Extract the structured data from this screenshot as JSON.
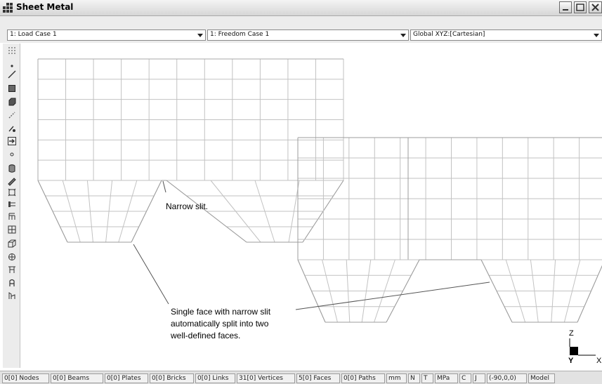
{
  "window": {
    "title": "Sheet Metal"
  },
  "toolbar": {
    "load_case": "1: Load Case 1",
    "freedom_case": "1: Freedom Case 1",
    "coordinate_system": "Global XYZ:[Cartesian]"
  },
  "left_toolbar": {
    "icons": [
      "node-icon",
      "line-beam-icon",
      "plate-icon",
      "brick-icon",
      "link-icon",
      "vertex-icon",
      "load-arrow-icon",
      "point-icon",
      "cylinder-icon",
      "ruler-icon",
      "face-icon",
      "path-icon",
      "extrude-icon",
      "grid-icon",
      "mesh-icon",
      "solid-mesh-icon",
      "beam-section-icon",
      "restraint-icon",
      "sweep-icon"
    ]
  },
  "annotations": {
    "slit": "Narrow slit.",
    "split_line1": "Single face with narrow slit",
    "split_line2": "automatically split into two",
    "split_line3": "well-defined faces."
  },
  "axes": {
    "z": "Z",
    "y": "Y",
    "x": "X"
  },
  "statusbar": {
    "items": [
      "0[0] Nodes",
      "0[0] Beams",
      "0[0] Plates",
      "0[0] Bricks",
      "0[0] Links",
      "31[0] Vertices",
      "5[0] Faces",
      "0[0] Paths",
      "mm",
      "N",
      "T",
      "MPa",
      "C",
      "J",
      "(-90,0,0)",
      "Model"
    ]
  }
}
